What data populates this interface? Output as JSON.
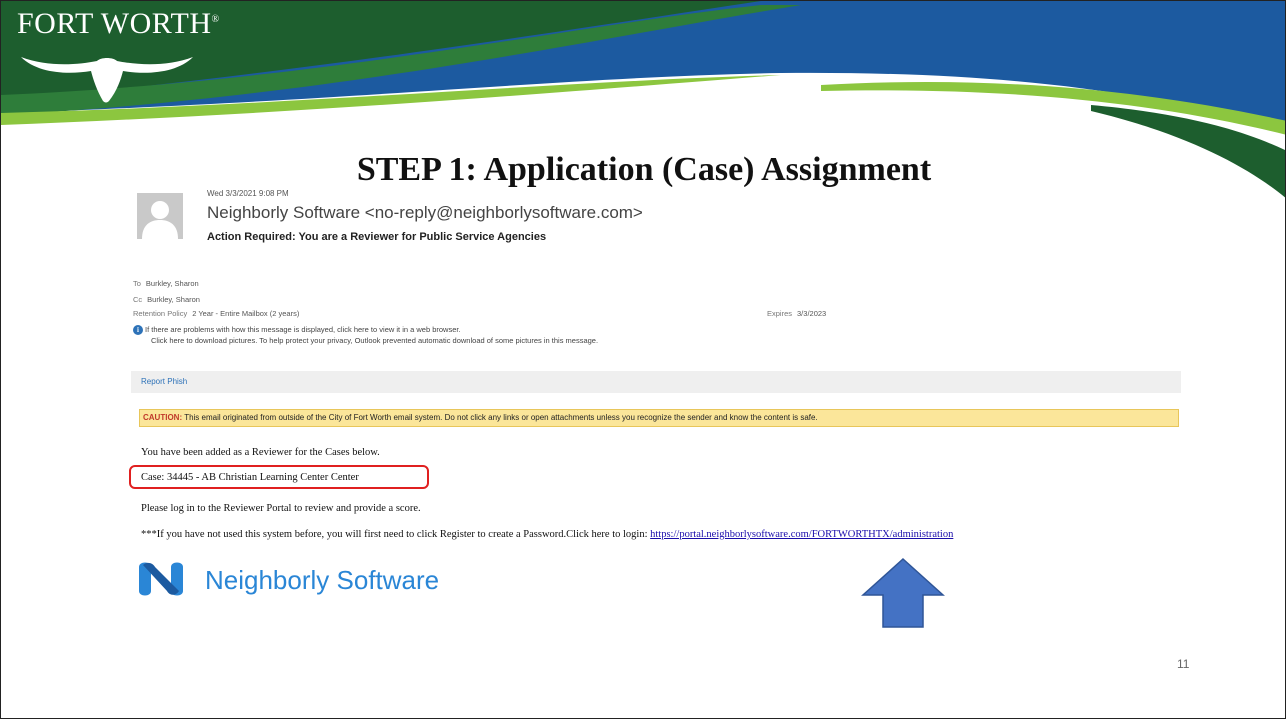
{
  "slide": {
    "logo": "FORT WORTH",
    "logo_mark": "®",
    "title": "STEP 1: Application (Case) Assignment",
    "page_number": "11"
  },
  "email": {
    "date": "Wed 3/3/2021 9:08 PM",
    "sender": "Neighborly Software <no-reply@neighborlysoftware.com>",
    "subject": "Action Required: You are a Reviewer for Public Service Agencies",
    "to_label": "To",
    "to_value": "Burkley, Sharon",
    "cc_label": "Cc",
    "cc_value": "Burkley, Sharon",
    "retention_label": "Retention Policy",
    "retention_value": "2 Year - Entire Mailbox (2 years)",
    "expires_label": "Expires",
    "expires_value": "3/3/2023",
    "info_line1": "If there are problems with how this message is displayed, click here to view it in a web browser.",
    "info_line2": "Click here to download pictures. To help protect your privacy, Outlook prevented automatic download of some pictures in this message.",
    "report_phish": "Report Phish",
    "caution_label": "CAUTION:",
    "caution_text": "This email originated from outside of the City of Fort Worth email system. Do not click any links or open attachments unless you recognize the sender and know the content is safe.",
    "body_line1": "You have been added as a Reviewer for the Cases below.",
    "case_line": "Case: 34445 - AB Christian Learning Center Center",
    "body_line2": "Please log in to the Reviewer Portal to review and provide a score.",
    "register_text": "***If you have not used this system before, you will first need to click Register to create a Password.Click here to login: ",
    "portal_url": "https://portal.neighborlysoftware.com/FORTWORTHTX/administration",
    "brand_name": "Neighborly Software"
  },
  "colors": {
    "banner_green": "#1d5e2e",
    "banner_lime": "#8cc63f",
    "banner_blue": "#1c5aa0",
    "arrow_blue": "#4472c4",
    "highlight_red": "#e02020",
    "caution_yellow": "#fbe69a"
  }
}
